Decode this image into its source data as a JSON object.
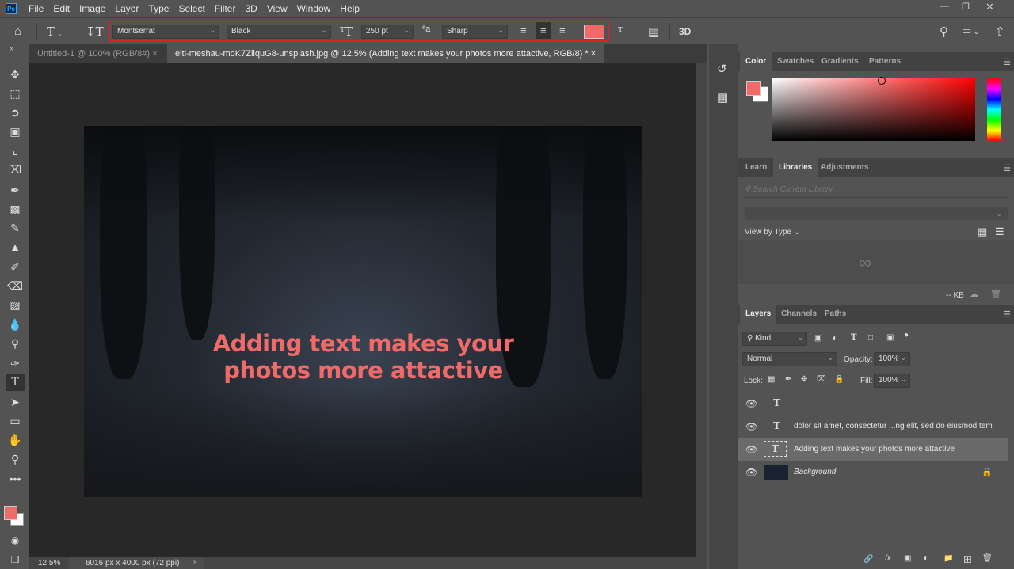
{
  "app": {
    "logo": "Ps"
  },
  "menu": [
    "File",
    "Edit",
    "Image",
    "Layer",
    "Type",
    "Select",
    "Filter",
    "3D",
    "View",
    "Window",
    "Help"
  ],
  "options": {
    "font_family": "Montserrat",
    "font_style": "Black",
    "font_size": "250 pt",
    "antialias": "Sharp",
    "text_color": "#f06a6a",
    "three_d": "3D"
  },
  "tabs": [
    {
      "label": "Untitled-1 @ 100% (RGB/8#)",
      "active": false
    },
    {
      "label": "elti-meshau-moK7ZiiquG8-unsplash.jpg @ 12.5% (Adding text makes your photos more attactive, RGB/8) *",
      "active": true
    }
  ],
  "canvas": {
    "headline_line1": "Adding text makes your",
    "headline_line2": "photos more attactive"
  },
  "status": {
    "zoom": "12.5%",
    "doc_size": "6016 px x 4000 px (72 ppi)"
  },
  "color_panel": {
    "tabs": [
      "Color",
      "Swatches",
      "Gradients",
      "Patterns"
    ],
    "foreground": "#f06a6a",
    "background": "#ffffff"
  },
  "libraries_panel": {
    "tabs": [
      "Learn",
      "Libraries",
      "Adjustments"
    ],
    "search_placeholder": "Search Current Library",
    "view_by": "View by Type",
    "storage": "-- KB"
  },
  "layers_panel": {
    "tabs": [
      "Layers",
      "Channels",
      "Paths"
    ],
    "filter": "Kind",
    "blend_mode": "Normal",
    "opacity_label": "Opacity:",
    "opacity": "100%",
    "lock_label": "Lock:",
    "fill_label": "Fill:",
    "fill": "100%",
    "layers": [
      {
        "name": "",
        "type": "text"
      },
      {
        "name": "dolor sit amet, consectetur ...ng elit, sed do eiusmod tem",
        "type": "text"
      },
      {
        "name": "Adding text makes your photos more attactive",
        "type": "text",
        "selected": true
      },
      {
        "name": "Background",
        "type": "image",
        "locked": true
      }
    ]
  }
}
